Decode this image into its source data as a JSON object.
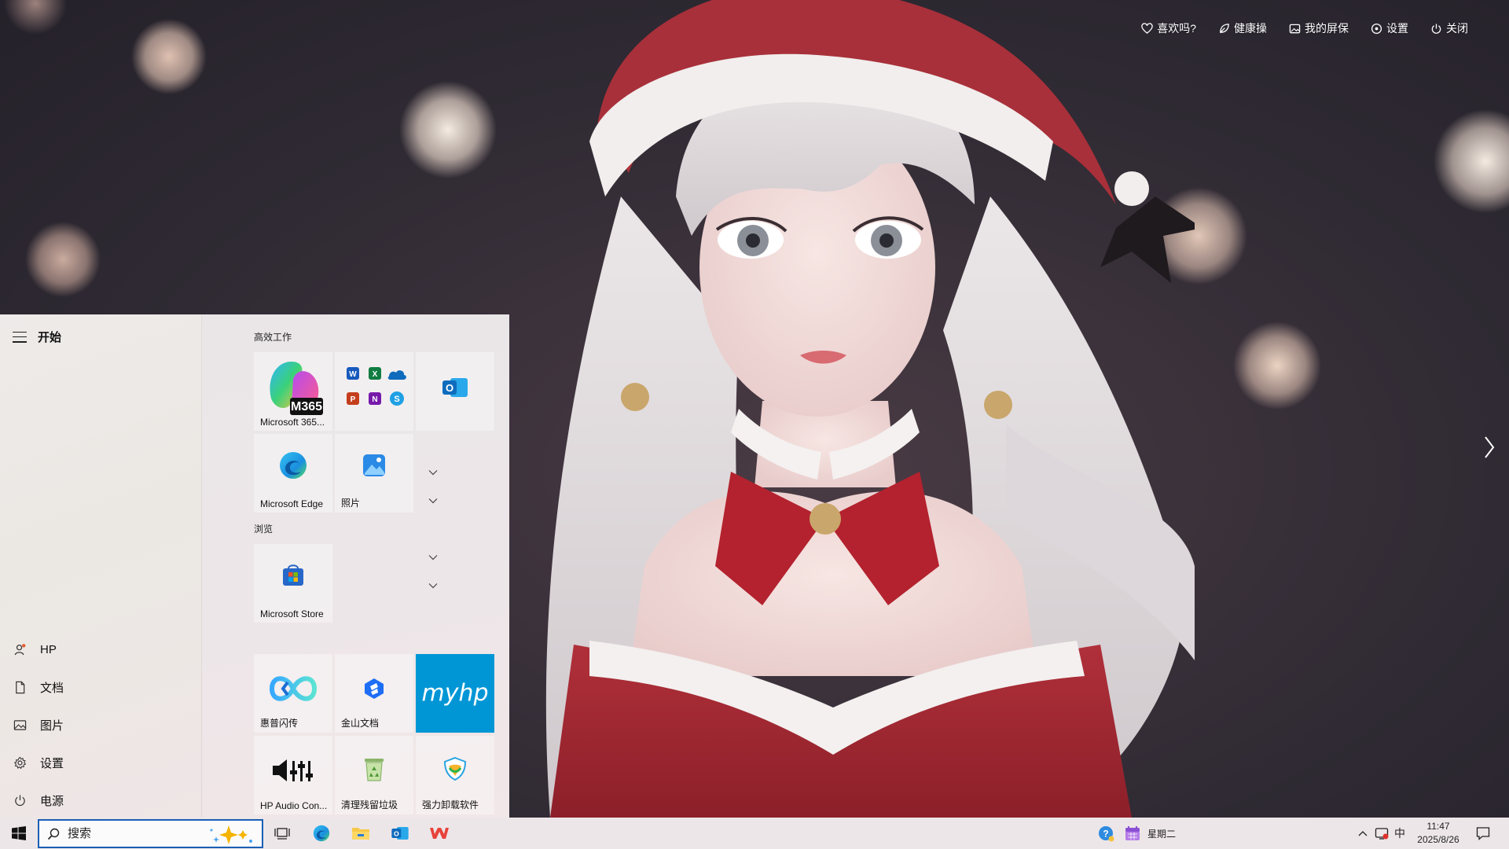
{
  "wallpaper_toolbar": {
    "like_label": "喜欢吗?",
    "health_label": "健康操",
    "screensaver_label": "我的屏保",
    "settings_label": "设置",
    "close_label": "关闭"
  },
  "start_menu": {
    "title": "开始",
    "side_items": [
      {
        "label": "HP",
        "icon": "user-icon"
      },
      {
        "label": "文档",
        "icon": "document-icon"
      },
      {
        "label": "图片",
        "icon": "picture-icon"
      },
      {
        "label": "设置",
        "icon": "gear-icon"
      },
      {
        "label": "电源",
        "icon": "power-icon"
      }
    ],
    "groups": {
      "productivity": "高效工作",
      "browse": "浏览"
    },
    "tiles": {
      "m365": {
        "label": "Microsoft 365...",
        "badge": "M365"
      },
      "office": {
        "label": ""
      },
      "outlook": {
        "label": ""
      },
      "edge": {
        "label": "Microsoft Edge"
      },
      "photos": {
        "label": "照片"
      },
      "store": {
        "label": "Microsoft Store"
      },
      "hp_flash": {
        "label": "惠普闪传"
      },
      "kingsoft_docs": {
        "label": "金山文档"
      },
      "myhp": {
        "label": "",
        "logo_text": "myhp"
      },
      "hp_audio": {
        "label": "HP Audio Con..."
      },
      "cleaner": {
        "label": "清理残留垃圾"
      },
      "uninstaller": {
        "label": "强力卸载软件"
      }
    }
  },
  "taskbar": {
    "search_placeholder": "搜索",
    "widget_label": "星期二",
    "ime_label": "中",
    "time": "11:47",
    "date": "2025/8/26"
  },
  "colors": {
    "accent": "#1a5fb4",
    "myhp_tile": "#0096d6",
    "wps_red": "#e8433a"
  }
}
